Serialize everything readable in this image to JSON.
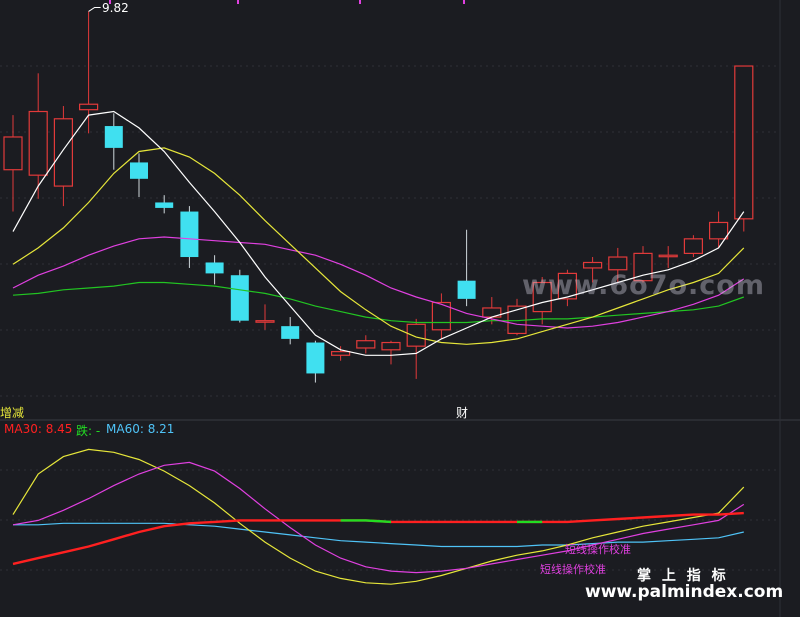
{
  "upper_panel": {
    "max_price_label": "9.82",
    "event_label_left": "增减",
    "event_label_mid": "财"
  },
  "lower_panel": {
    "legend": [
      {
        "text": "MA30: 8.45",
        "color": "#ff2020"
      },
      {
        "text": "跌: -",
        "color": "#22dd22"
      },
      {
        "text": "MA60: 8.21",
        "color": "#4fc3f7"
      }
    ],
    "annotation_1": "短线操作校准",
    "annotation_2": "短线操作校准"
  },
  "watermarks": {
    "url_top": "www.6o7o.com",
    "cn_brand": "掌 上 指 标",
    "url_bottom": "www.palmindex.com"
  },
  "chart_data": {
    "type": "candlestick",
    "title": "",
    "colors": {
      "up": "#e23a3a",
      "down": "#40e0f0",
      "ma5": "#ffffff",
      "ma10": "#e6e63a",
      "ma20": "#e040e0",
      "ma60": "#22c522"
    },
    "candles": [
      {
        "o": 8.95,
        "h": 9.25,
        "l": 8.72,
        "c": 9.13
      },
      {
        "o": 8.92,
        "h": 9.48,
        "l": 8.79,
        "c": 9.27
      },
      {
        "o": 8.86,
        "h": 9.3,
        "l": 8.75,
        "c": 9.23
      },
      {
        "o": 9.28,
        "h": 9.82,
        "l": 9.15,
        "c": 9.31
      },
      {
        "o": 9.19,
        "h": 9.26,
        "l": 8.95,
        "c": 9.07
      },
      {
        "o": 8.99,
        "h": 9.04,
        "l": 8.8,
        "c": 8.9
      },
      {
        "o": 8.77,
        "h": 8.81,
        "l": 8.71,
        "c": 8.74
      },
      {
        "o": 8.72,
        "h": 8.75,
        "l": 8.41,
        "c": 8.47
      },
      {
        "o": 8.44,
        "h": 8.48,
        "l": 8.32,
        "c": 8.38
      },
      {
        "o": 8.37,
        "h": 8.4,
        "l": 8.11,
        "c": 8.12
      },
      {
        "o": 8.12,
        "h": 8.21,
        "l": 8.07,
        "c": 8.12
      },
      {
        "o": 8.09,
        "h": 8.14,
        "l": 7.99,
        "c": 8.02
      },
      {
        "o": 8.0,
        "h": 8.01,
        "l": 7.78,
        "c": 7.83
      },
      {
        "o": 7.93,
        "h": 7.98,
        "l": 7.9,
        "c": 7.95
      },
      {
        "o": 7.97,
        "h": 8.04,
        "l": 7.94,
        "c": 8.01
      },
      {
        "o": 7.96,
        "h": 8.01,
        "l": 7.88,
        "c": 8.0
      },
      {
        "o": 7.98,
        "h": 8.13,
        "l": 7.8,
        "c": 8.1
      },
      {
        "o": 8.07,
        "h": 8.27,
        "l": 8.02,
        "c": 8.22
      },
      {
        "o": 8.34,
        "h": 8.62,
        "l": 8.2,
        "c": 8.24
      },
      {
        "o": 8.14,
        "h": 8.25,
        "l": 8.1,
        "c": 8.19
      },
      {
        "o": 8.05,
        "h": 8.24,
        "l": 8.04,
        "c": 8.2
      },
      {
        "o": 8.17,
        "h": 8.36,
        "l": 8.1,
        "c": 8.33
      },
      {
        "o": 8.24,
        "h": 8.4,
        "l": 8.2,
        "c": 8.38
      },
      {
        "o": 8.41,
        "h": 8.47,
        "l": 8.33,
        "c": 8.44
      },
      {
        "o": 8.4,
        "h": 8.52,
        "l": 8.33,
        "c": 8.47
      },
      {
        "o": 8.34,
        "h": 8.53,
        "l": 8.33,
        "c": 8.49
      },
      {
        "o": 8.48,
        "h": 8.53,
        "l": 8.41,
        "c": 8.48
      },
      {
        "o": 8.49,
        "h": 8.59,
        "l": 8.47,
        "c": 8.57
      },
      {
        "o": 8.57,
        "h": 8.72,
        "l": 8.52,
        "c": 8.66
      },
      {
        "o": 8.68,
        "h": 9.52,
        "l": 8.61,
        "c": 9.52
      }
    ],
    "ma5": [
      8.61,
      8.86,
      9.06,
      9.25,
      9.27,
      9.18,
      9.05,
      8.88,
      8.72,
      8.55,
      8.36,
      8.2,
      8.04,
      7.96,
      7.93,
      7.93,
      7.94,
      8.02,
      8.08,
      8.14,
      8.18,
      8.22,
      8.25,
      8.29,
      8.33,
      8.37,
      8.4,
      8.45,
      8.52,
      8.72
    ],
    "ma10": [
      8.43,
      8.52,
      8.63,
      8.77,
      8.93,
      9.05,
      9.07,
      9.02,
      8.93,
      8.81,
      8.67,
      8.54,
      8.41,
      8.28,
      8.18,
      8.09,
      8.03,
      8.0,
      7.99,
      8.0,
      8.02,
      8.06,
      8.1,
      8.14,
      8.19,
      8.24,
      8.29,
      8.33,
      8.38,
      8.52
    ],
    "ma20": [
      8.3,
      8.37,
      8.42,
      8.48,
      8.53,
      8.57,
      8.58,
      8.57,
      8.56,
      8.55,
      8.54,
      8.51,
      8.48,
      8.43,
      8.37,
      8.3,
      8.25,
      8.21,
      8.16,
      8.13,
      8.1,
      8.09,
      8.08,
      8.09,
      8.11,
      8.14,
      8.17,
      8.21,
      8.26,
      8.35
    ],
    "ma60": [
      8.26,
      8.27,
      8.29,
      8.3,
      8.31,
      8.33,
      8.33,
      8.32,
      8.31,
      8.29,
      8.27,
      8.24,
      8.2,
      8.17,
      8.14,
      8.12,
      8.11,
      8.11,
      8.11,
      8.12,
      8.12,
      8.13,
      8.13,
      8.14,
      8.15,
      8.16,
      8.17,
      8.18,
      8.2,
      8.25
    ],
    "ylim": [
      7.75,
      9.85
    ],
    "lower_series": {
      "yellow": [
        0.52,
        0.8,
        0.92,
        0.97,
        0.95,
        0.9,
        0.82,
        0.72,
        0.6,
        0.46,
        0.33,
        0.22,
        0.13,
        0.08,
        0.05,
        0.04,
        0.06,
        0.1,
        0.15,
        0.2,
        0.24,
        0.27,
        0.31,
        0.36,
        0.4,
        0.44,
        0.47,
        0.5,
        0.53,
        0.71
      ],
      "magenta": [
        0.45,
        0.48,
        0.55,
        0.63,
        0.72,
        0.8,
        0.86,
        0.88,
        0.82,
        0.7,
        0.56,
        0.43,
        0.31,
        0.22,
        0.16,
        0.13,
        0.12,
        0.13,
        0.15,
        0.18,
        0.21,
        0.24,
        0.27,
        0.31,
        0.35,
        0.39,
        0.42,
        0.45,
        0.48,
        0.59
      ],
      "ma30": [
        0.18,
        0.22,
        0.26,
        0.3,
        0.35,
        0.4,
        0.44,
        0.46,
        0.47,
        0.48,
        0.48,
        0.48,
        0.48,
        0.48,
        0.48,
        0.47,
        0.47,
        0.47,
        0.47,
        0.47,
        0.47,
        0.47,
        0.47,
        0.48,
        0.49,
        0.5,
        0.51,
        0.52,
        0.52,
        0.53
      ],
      "ma60": [
        0.45,
        0.45,
        0.46,
        0.46,
        0.46,
        0.46,
        0.46,
        0.45,
        0.44,
        0.42,
        0.4,
        0.38,
        0.36,
        0.34,
        0.33,
        0.32,
        0.31,
        0.3,
        0.3,
        0.3,
        0.3,
        0.31,
        0.31,
        0.32,
        0.33,
        0.33,
        0.34,
        0.35,
        0.36,
        0.4
      ]
    }
  }
}
